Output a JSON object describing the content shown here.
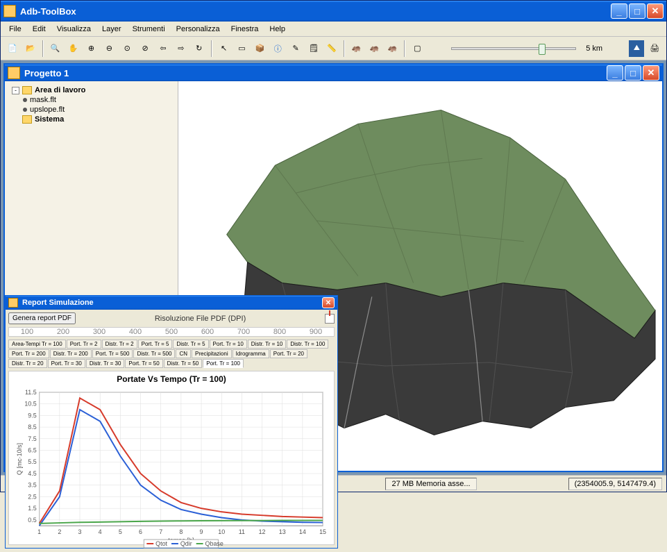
{
  "app": {
    "title": "Adb-ToolBox"
  },
  "menu": {
    "items": [
      "File",
      "Edit",
      "Visualizza",
      "Layer",
      "Strumenti",
      "Personalizza",
      "Finestra",
      "Help"
    ]
  },
  "toolbar": {
    "scale_label": "5 km"
  },
  "project": {
    "title": "Progetto 1",
    "tree": {
      "root1": "Area di lavoro",
      "child1": "mask.flt",
      "child2": "upslope.flt",
      "root2": "Sistema"
    }
  },
  "report": {
    "title": "Report Simulazione",
    "btn_generate": "Genera report PDF",
    "lbl_resolution": "Risoluzione File PDF (DPI)",
    "ruler_ticks": [
      "100",
      "200",
      "300",
      "400",
      "500",
      "600",
      "700",
      "800",
      "900"
    ],
    "tabs": [
      "Area-Tempi Tr = 100",
      "Port. Tr = 2",
      "Distr. Tr = 2",
      "Port. Tr = 5",
      "Distr. Tr = 5",
      "Port. Tr = 10",
      "Distr. Tr = 10",
      "Distr. Tr = 100",
      "Port. Tr = 200",
      "Distr. Tr = 200",
      "Port. Tr = 500",
      "Distr. Tr = 500",
      "CN",
      "Precipitazioni",
      "Idrogramma",
      "Port. Tr = 20",
      "Distr. Tr = 20",
      "Port. Tr = 30",
      "Distr. Tr = 30",
      "Port. Tr = 50",
      "Distr. Tr = 50",
      "Port. Tr = 100"
    ],
    "active_tab": 21,
    "chart_title": "Portate Vs Tempo (Tr = 100)",
    "xlabel": "tempo [h]",
    "ylabel": "Q [mc·10/s]",
    "legend": [
      "Qtot",
      "Qdir",
      "Qbase"
    ]
  },
  "status": {
    "memory": "27 MB Memoria asse...",
    "coords": "(2354005.9, 5147479.4)"
  },
  "chart_data": {
    "type": "line",
    "title": "Portate Vs Tempo (Tr = 100)",
    "xlabel": "tempo [h]",
    "ylabel": "Q [mc·10/s]",
    "x": [
      1,
      2,
      3,
      4,
      5,
      6,
      7,
      8,
      9,
      10,
      11,
      12,
      13,
      14,
      15
    ],
    "series": [
      {
        "name": "Qtot",
        "color": "#d63a2a",
        "values": [
          0.2,
          3.0,
          11.0,
          10.0,
          7.0,
          4.5,
          3.0,
          2.0,
          1.5,
          1.2,
          1.0,
          0.9,
          0.8,
          0.75,
          0.7
        ]
      },
      {
        "name": "Qdir",
        "color": "#2a5fd6",
        "values": [
          0.0,
          2.5,
          10.0,
          9.0,
          6.0,
          3.5,
          2.2,
          1.4,
          1.0,
          0.7,
          0.5,
          0.4,
          0.35,
          0.3,
          0.28
        ]
      },
      {
        "name": "Qbase",
        "color": "#4aa64a",
        "values": [
          0.2,
          0.25,
          0.3,
          0.32,
          0.35,
          0.38,
          0.4,
          0.42,
          0.43,
          0.44,
          0.45,
          0.45,
          0.46,
          0.46,
          0.46
        ]
      }
    ],
    "xlim": [
      1,
      15
    ],
    "ylim": [
      0,
      11.5
    ],
    "yticks": [
      0.5,
      1.5,
      2.5,
      3.5,
      4.5,
      5.5,
      6.5,
      7.5,
      8.5,
      9.5,
      10.5,
      11.5
    ]
  }
}
